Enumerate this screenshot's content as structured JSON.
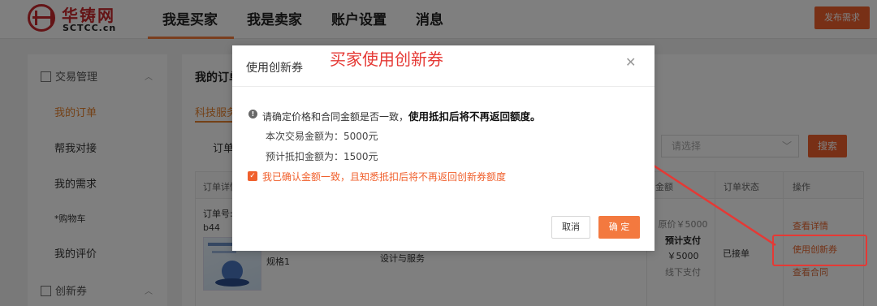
{
  "logo": {
    "cn": "华铸网",
    "en": "SCTCC.cn"
  },
  "nav": {
    "buyer": "我是买家",
    "seller": "我是卖家",
    "account": "账户设置",
    "messages": "消息",
    "publish": "发布需求"
  },
  "sidebar": {
    "group1": "交易管理",
    "items": [
      "我的订单",
      "帮我对接",
      "我的需求",
      "*购物车",
      "我的评价"
    ],
    "group2": "创新券"
  },
  "main": {
    "title": "我的订单",
    "tab": "科技服务",
    "filter_label": "订单",
    "select_placeholder": "请选择",
    "search": "搜索",
    "columns": [
      "订单详情",
      "金额",
      "订单状态",
      "操作"
    ],
    "order": {
      "no_label": "订单号:",
      "no_value": "b44",
      "spec": "规格1",
      "category": "设计与服务",
      "original_price": "原价￥5000",
      "expected_label": "预计支付",
      "expected_value": "￥5000",
      "pay_mode": "线下支付",
      "status": "已接单",
      "ops": [
        "查看详情",
        "使用创新券",
        "查看合同"
      ]
    }
  },
  "modal": {
    "title": "使用创新券",
    "annotation": "买家使用创新券",
    "warning": "请确定价格和合同金额是否一致，",
    "warning_bold": "使用抵扣后将不再返回额度。",
    "line1": "本次交易金额为：5000元",
    "line2": "预计抵扣金额为：1500元",
    "checkbox": "我已确认金额一致，且知悉抵扣后将不再返回创新券额度",
    "cancel": "取消",
    "confirm": "确 定"
  },
  "colors": {
    "brand_red": "#c8282d",
    "accent_orange": "#f0602d",
    "annotation_red": "#e53935"
  }
}
